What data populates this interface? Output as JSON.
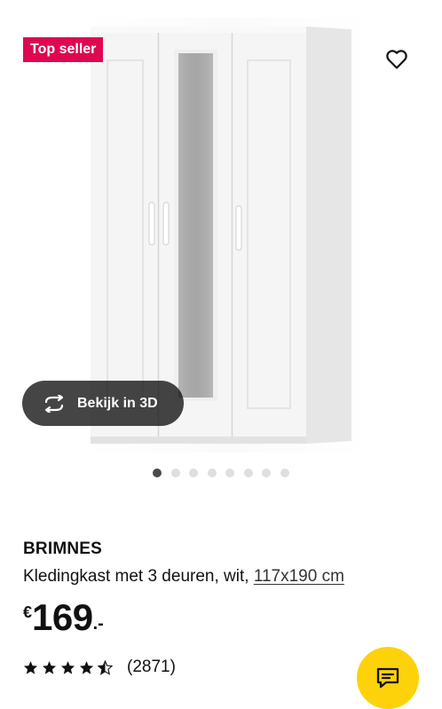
{
  "badge": {
    "label": "Top seller"
  },
  "hero": {
    "image_alt": "BRIMNES kledingkast met 3 deuren, wit",
    "view3d_label": "Bekijk in 3D",
    "carousel": {
      "count": 8,
      "active_index": 0
    }
  },
  "product": {
    "name": "BRIMNES",
    "description": "Kledingkast met 3 deuren, wit,",
    "size_link": "117x190 cm",
    "price": {
      "currency": "€",
      "integer": "169",
      "suffix": ".-"
    },
    "rating": {
      "score": 4.5,
      "max": 5,
      "count_label": "(2871)"
    }
  },
  "colors": {
    "badge": "#e00751",
    "chat_button": "#fdd20a",
    "text": "#111111"
  },
  "icons": {
    "favorite": "heart-outline-icon",
    "view3d": "rotate-3d-icon",
    "chat": "chat-bubble-icon",
    "star": "star-icon"
  }
}
